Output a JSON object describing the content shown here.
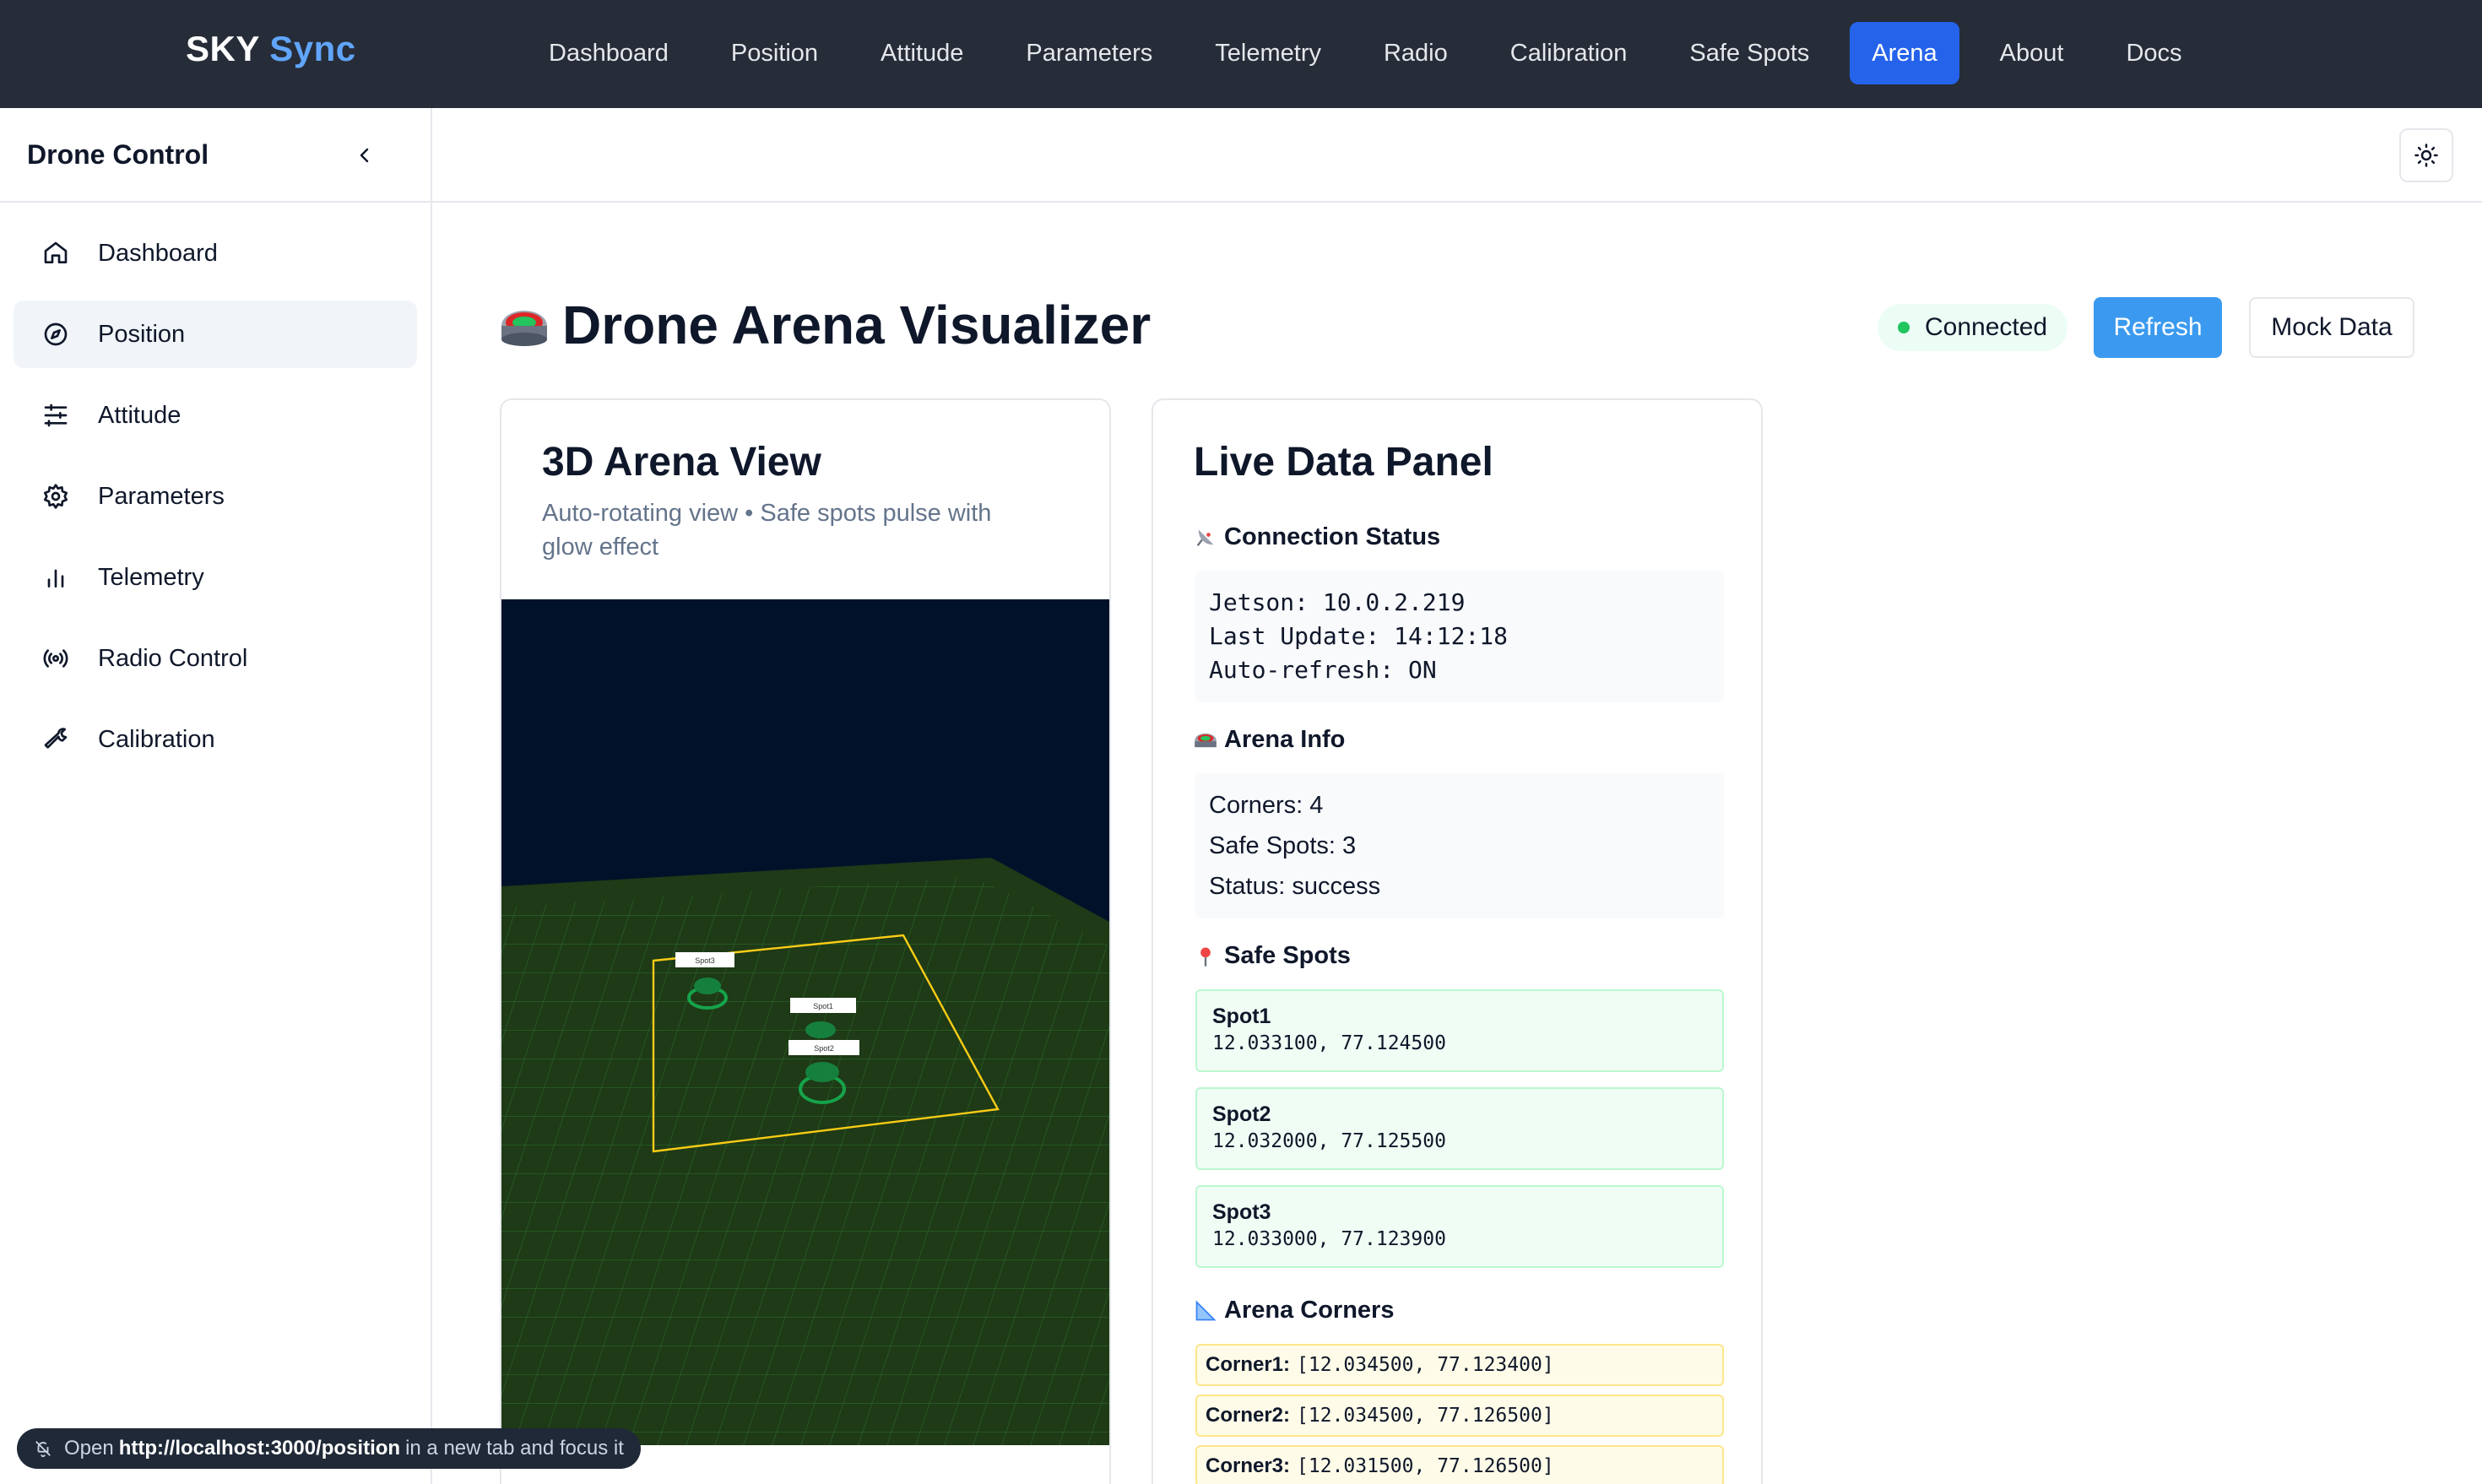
{
  "brand": {
    "first": "SKY",
    "second": "Sync"
  },
  "topnav": [
    {
      "label": "Dashboard"
    },
    {
      "label": "Position"
    },
    {
      "label": "Attitude"
    },
    {
      "label": "Parameters"
    },
    {
      "label": "Telemetry"
    },
    {
      "label": "Radio"
    },
    {
      "label": "Calibration"
    },
    {
      "label": "Safe Spots"
    },
    {
      "label": "Arena",
      "active": true
    },
    {
      "label": "About"
    },
    {
      "label": "Docs"
    }
  ],
  "sidebar": {
    "title": "Drone Control",
    "items": [
      {
        "label": "Dashboard",
        "icon": "home-icon"
      },
      {
        "label": "Position",
        "icon": "compass-icon",
        "active": true
      },
      {
        "label": "Attitude",
        "icon": "sliders-icon"
      },
      {
        "label": "Parameters",
        "icon": "gear-icon"
      },
      {
        "label": "Telemetry",
        "icon": "bar-chart-icon"
      },
      {
        "label": "Radio Control",
        "icon": "radio-signal-icon"
      },
      {
        "label": "Calibration",
        "icon": "wrench-icon"
      }
    ]
  },
  "page": {
    "title": "Drone Arena Visualizer",
    "status": "Connected",
    "refresh_label": "Refresh",
    "mock_label": "Mock Data"
  },
  "arena_card": {
    "title": "3D Arena View",
    "subtitle": "Auto-rotating view • Safe spots pulse with glow effect",
    "markers": [
      "Spot3",
      "Spot1",
      "Spot2"
    ]
  },
  "live_panel": {
    "title": "Live Data Panel",
    "connection": {
      "heading": "Connection Status",
      "lines": [
        "Jetson: 10.0.2.219",
        "Last Update: 14:12:18",
        "Auto-refresh: ON"
      ]
    },
    "arena_info": {
      "heading": "Arena Info",
      "lines": [
        "Corners: 4",
        "Safe Spots: 3",
        "Status: success"
      ]
    },
    "safe_spots": {
      "heading": "Safe Spots",
      "items": [
        {
          "name": "Spot1",
          "coords": "12.033100, 77.124500"
        },
        {
          "name": "Spot2",
          "coords": "12.032000, 77.125500"
        },
        {
          "name": "Spot3",
          "coords": "12.033000, 77.123900"
        }
      ]
    },
    "corners": {
      "heading": "Arena Corners",
      "items": [
        {
          "label": "Corner1:",
          "value": "[12.034500, 77.123400]"
        },
        {
          "label": "Corner2:",
          "value": "[12.034500, 77.126500]"
        },
        {
          "label": "Corner3:",
          "value": "[12.031500, 77.126500]"
        }
      ]
    }
  },
  "toast": {
    "pre": "Open",
    "url": "http://localhost:3000/position",
    "post": "in a new tab and focus it"
  },
  "colors": {
    "accent": "#2563eb",
    "nav_bg": "#262c38",
    "connected": "#22c55e",
    "arena_ground": "#1e3a17",
    "arena_border": "#facc15"
  }
}
